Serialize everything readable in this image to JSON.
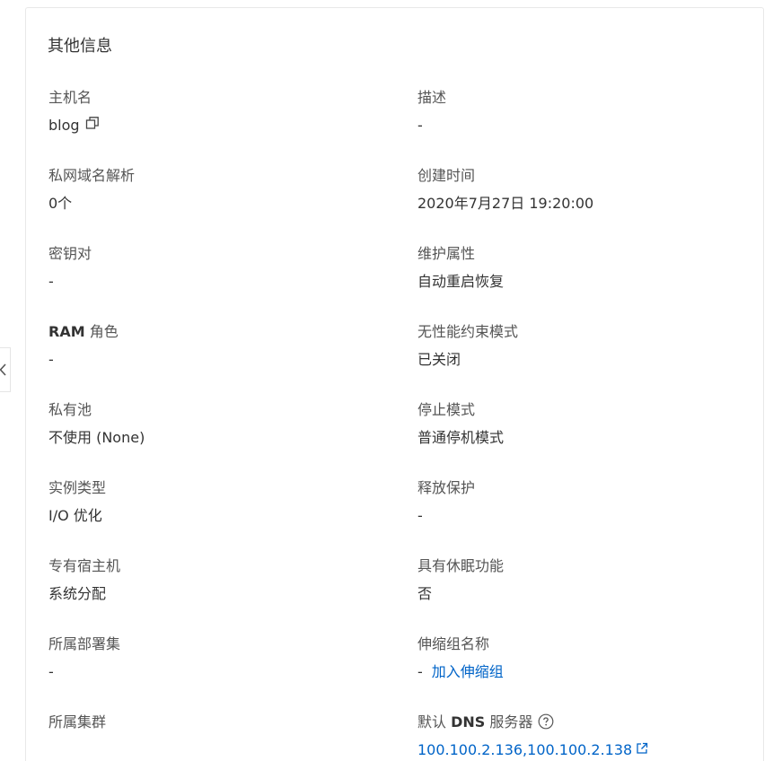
{
  "section": {
    "title": "其他信息"
  },
  "fields_left": [
    {
      "label": "主机名",
      "value": "blog"
    },
    {
      "label": "私网域名解析",
      "value": "0个"
    },
    {
      "label": "密钥对",
      "value": "-"
    },
    {
      "label": "RAM 角色",
      "label_strong": "RAM",
      "label_rest": " 角色",
      "value": "-"
    },
    {
      "label": "私有池",
      "value": "不使用 (None)"
    },
    {
      "label": "实例类型",
      "value": "I/O 优化"
    },
    {
      "label": "专有宿主机",
      "value": "系统分配"
    },
    {
      "label": "所属部署集",
      "value": "-"
    },
    {
      "label": "所属集群",
      "value": ""
    }
  ],
  "fields_right": [
    {
      "label": "描述",
      "value": "-"
    },
    {
      "label": "创建时间",
      "value": "2020年7月27日 19:20:00"
    },
    {
      "label": "维护属性",
      "value": "自动重启恢复"
    },
    {
      "label": "无性能约束模式",
      "value": "已关闭"
    },
    {
      "label": "停止模式",
      "value": "普通停机模式"
    },
    {
      "label": "释放保护",
      "value": "-"
    },
    {
      "label": "具有休眠功能",
      "value": "否"
    },
    {
      "label": "伸缩组名称",
      "value": "-",
      "link": "加入伸缩组"
    },
    {
      "label_prefix": "默认 ",
      "label_strong": "DNS",
      "label_rest": " 服务器",
      "value": "100.100.2.136,100.100.2.138"
    }
  ],
  "icons": {
    "copy": "copy-icon",
    "help": "help-circle-icon",
    "external": "external-link-icon",
    "collapse": "chevron-left-icon"
  },
  "colors": {
    "link": "#0064c8",
    "text": "#333333",
    "label": "#555555",
    "border": "#e8e8e8"
  }
}
